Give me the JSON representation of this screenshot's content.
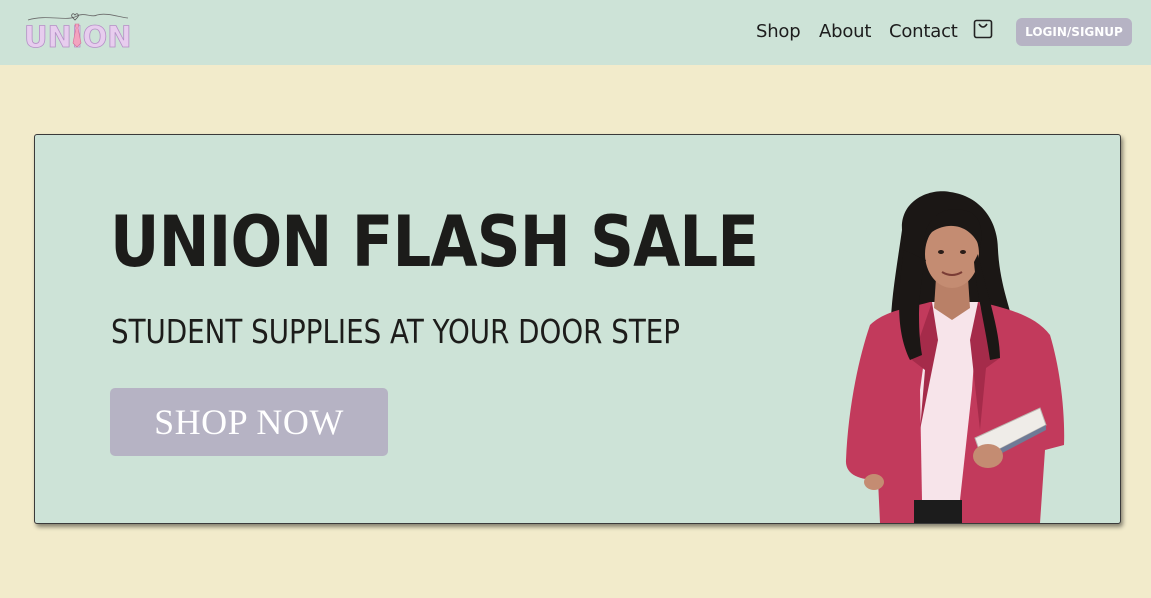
{
  "navbar": {
    "logo_text": "UNION",
    "links": [
      "Shop",
      "About",
      "Contact"
    ],
    "cart_icon": "shopping-bag-icon",
    "login_label": "LOGIN/SIGNUP"
  },
  "hero": {
    "title": "UNION FLASH SALE",
    "subtitle": "STUDENT SUPPLIES AT YOUR DOOR STEP",
    "cta_label": "SHOP NOW",
    "image": "student-holding-book-photo"
  },
  "colors": {
    "page_background": "#f2ebcb",
    "navbar_background": "#cde3d7",
    "hero_background": "#cde3d7",
    "button_background": "#b6b3c4",
    "logo_color": "#d8b7e0"
  }
}
